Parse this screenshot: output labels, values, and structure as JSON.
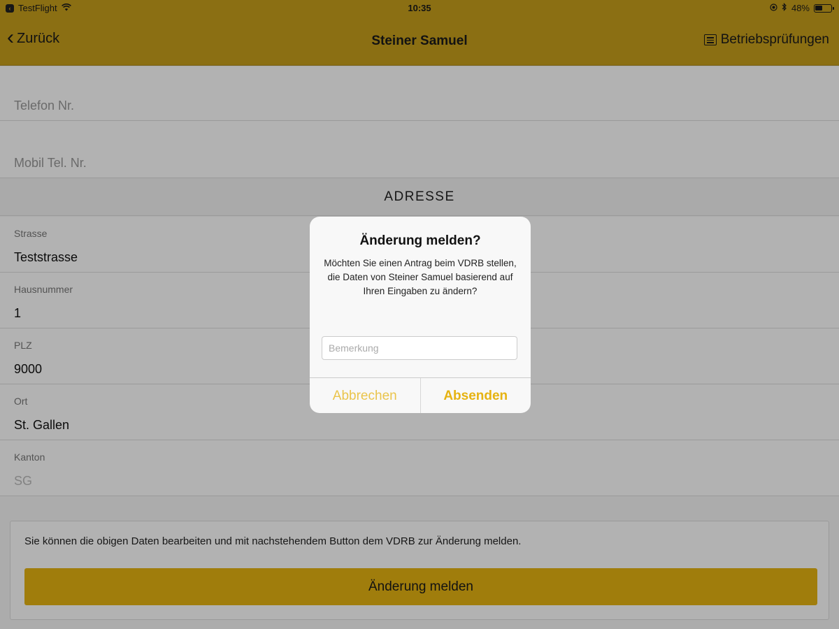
{
  "status_bar": {
    "app": "TestFlight",
    "time": "10:35",
    "battery_text": "48%",
    "battery_level": 0.48
  },
  "nav": {
    "back_label": "Zurück",
    "title": "Steiner Samuel",
    "right_label": "Betriebsprüfungen"
  },
  "fields_top": [
    {
      "placeholder": "Telefon Nr."
    },
    {
      "placeholder": "Mobil Tel. Nr."
    }
  ],
  "section": {
    "title": "ADRESSE"
  },
  "address": [
    {
      "label": "Strasse",
      "value": "Teststrasse"
    },
    {
      "label": "Hausnummer",
      "value": "1"
    },
    {
      "label": "PLZ",
      "value": "9000"
    },
    {
      "label": "Ort",
      "value": "St. Gallen"
    },
    {
      "label": "Kanton",
      "value": "SG"
    }
  ],
  "footer": {
    "info": "Sie können die obigen Daten bearbeiten und mit nachstehendem Button dem VDRB zur Änderung melden.",
    "button_label": "Änderung melden"
  },
  "dialog": {
    "title": "Änderung melden?",
    "message": "Möchten Sie einen Antrag beim VDRB stellen, die Daten von Steiner Samuel basierend auf Ihren Eingaben zu ändern?",
    "input_placeholder": "Bemerkung",
    "cancel_label": "Abbrechen",
    "submit_label": "Absenden"
  },
  "colors": {
    "nav_bar": "#c89f1c",
    "primary_button": "#e6b312"
  }
}
